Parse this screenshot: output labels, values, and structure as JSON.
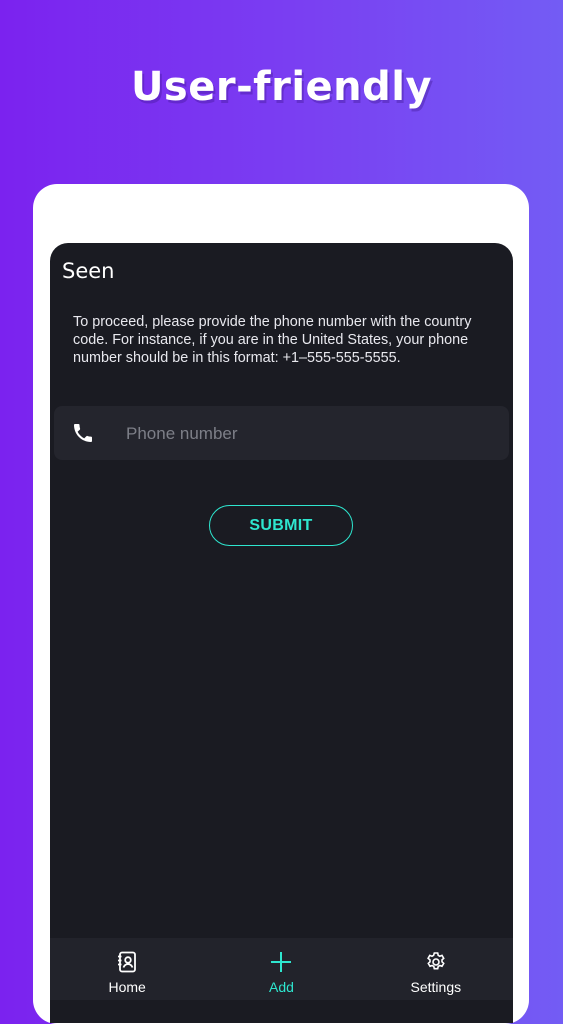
{
  "headline": "User-friendly",
  "app": {
    "title": "Seen",
    "instructions": "To proceed, please provide the phone number with the country code. For instance, if you are in the United States, your phone number should be in this format: +1–555-555-5555.",
    "phone_input": {
      "placeholder": "Phone number",
      "value": ""
    },
    "submit_label": "SUBMIT"
  },
  "nav": {
    "items": [
      {
        "label": "Home",
        "icon": "contact-book-icon"
      },
      {
        "label": "Add",
        "icon": "plus-icon"
      },
      {
        "label": "Settings",
        "icon": "gear-icon"
      }
    ],
    "active": "Add"
  },
  "colors": {
    "background_left": "#7b22ef",
    "background_right": "#735cf4",
    "screen": "#1a1b22",
    "accent": "#2ee6cf"
  }
}
